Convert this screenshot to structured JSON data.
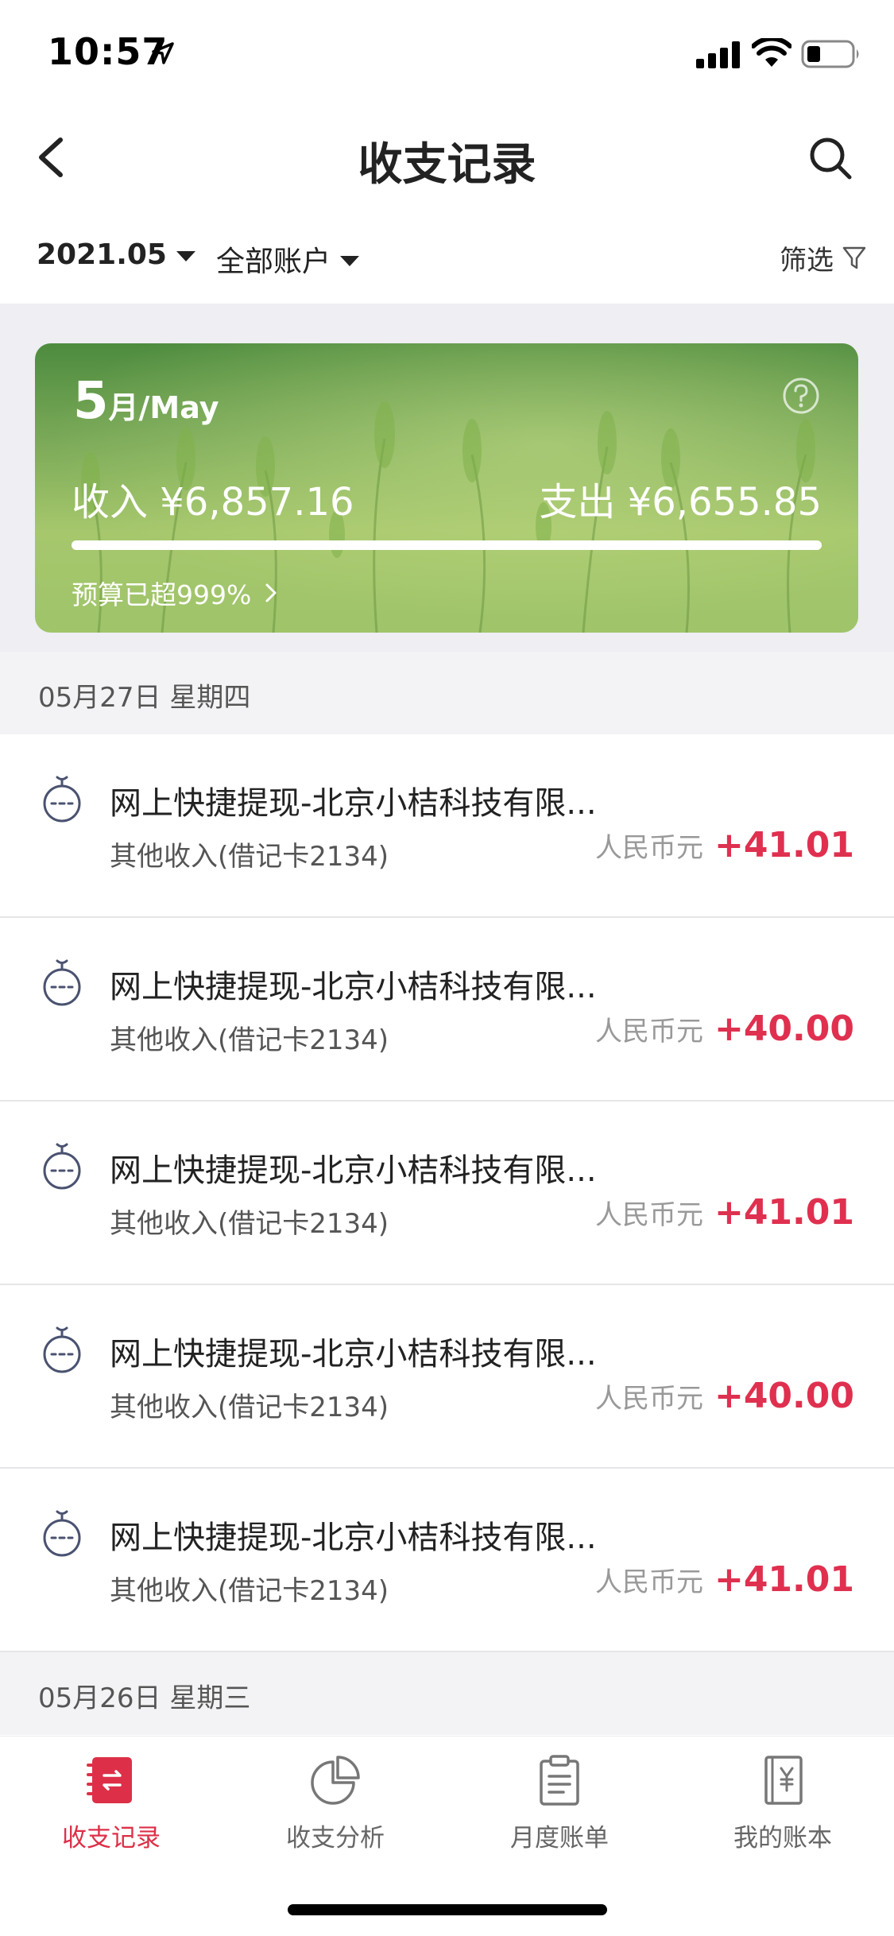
{
  "status_bar": {
    "time": "10:57",
    "icons": [
      "location-arrow-icon",
      "signal-icon",
      "wifi-icon",
      "battery-icon"
    ]
  },
  "nav": {
    "title": "收支记录",
    "back_icon": "chevron-left-icon",
    "search_icon": "search-icon"
  },
  "filters": {
    "date": "2021.05",
    "account": "全部账户",
    "screen": "筛选"
  },
  "summary": {
    "month_num": "5",
    "month_suffix": "月/May",
    "income": "收入 ¥6,857.16",
    "expense": "支出 ¥6,655.85",
    "budget": "预算已超999%",
    "budget_progress": 1.0
  },
  "sections": [
    {
      "date": "05月27日 星期四",
      "transactions": [
        {
          "title": "网上快捷提现-北京小桔科技有限...",
          "category": "其他收入(借记卡2134)",
          "currency": "人民币元",
          "amount": "+41.01"
        },
        {
          "title": "网上快捷提现-北京小桔科技有限...",
          "category": "其他收入(借记卡2134)",
          "currency": "人民币元",
          "amount": "+40.00"
        },
        {
          "title": "网上快捷提现-北京小桔科技有限...",
          "category": "其他收入(借记卡2134)",
          "currency": "人民币元",
          "amount": "+41.01"
        },
        {
          "title": "网上快捷提现-北京小桔科技有限...",
          "category": "其他收入(借记卡2134)",
          "currency": "人民币元",
          "amount": "+40.00"
        },
        {
          "title": "网上快捷提现-北京小桔科技有限...",
          "category": "其他收入(借记卡2134)",
          "currency": "人民币元",
          "amount": "+41.01"
        }
      ]
    },
    {
      "date": "05月26日 星期三",
      "transactions": []
    }
  ],
  "tabs": [
    {
      "label": "收支记录",
      "icon": "ledger-icon",
      "active": true
    },
    {
      "label": "收支分析",
      "icon": "pie-chart-icon",
      "active": false
    },
    {
      "label": "月度账单",
      "icon": "clipboard-icon",
      "active": false
    },
    {
      "label": "我的账本",
      "icon": "yuan-book-icon",
      "active": false
    }
  ],
  "colors": {
    "accent": "#dd3048",
    "amount_positive": "#e0304f",
    "card_green": "#78a857"
  }
}
